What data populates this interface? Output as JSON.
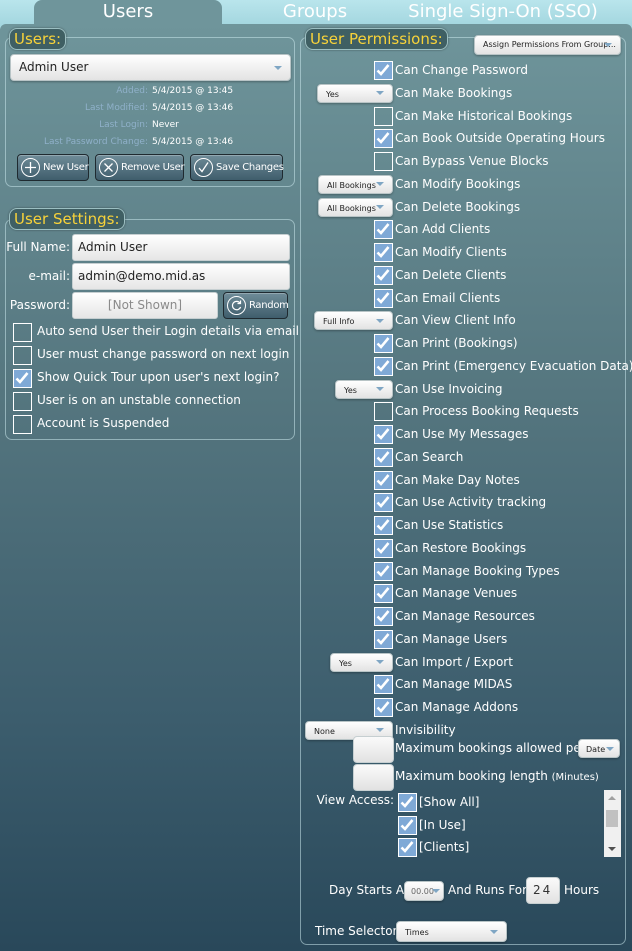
{
  "tabs": [
    {
      "label": "Users",
      "active": true
    },
    {
      "label": "Groups",
      "active": false
    },
    {
      "label": "Single Sign-On (SSO)",
      "active": false
    }
  ],
  "users_panel": {
    "legend": "Users:",
    "selected_user": "Admin User",
    "info": [
      {
        "label": "Added:",
        "value": "5/4/2015 @ 13:45"
      },
      {
        "label": "Last Modified:",
        "value": "5/4/2015 @ 13:46"
      },
      {
        "label": "Last Login:",
        "value": "Never"
      },
      {
        "label": "Last Password Change:",
        "value": "5/4/2015 @ 13:46"
      }
    ],
    "buttons": {
      "new_user": "New User",
      "remove_user": "Remove User",
      "save_changes": "Save Changes"
    }
  },
  "user_settings": {
    "legend": "User Settings:",
    "full_name_label": "Full Name:",
    "full_name_value": "Admin User",
    "email_label": "e-mail:",
    "email_value": "admin@demo.mid.as",
    "password_label": "Password:",
    "password_placeholder": "[Not Shown]",
    "random_button": "Random",
    "options": [
      {
        "label": "Auto send User their Login details via email",
        "checked": false
      },
      {
        "label": "User must change password on next login",
        "checked": false
      },
      {
        "label": "Show Quick Tour upon user's next login?",
        "checked": true
      },
      {
        "label": "User is on an unstable connection",
        "checked": false
      },
      {
        "label": "Account is Suspended",
        "checked": false
      }
    ]
  },
  "permissions": {
    "legend": "User Permissions:",
    "assign_from_group": "Assign Permissions From Group...",
    "items": [
      {
        "label": "Can Change Password",
        "type": "checkbox",
        "checked": true
      },
      {
        "label": "Can Make Bookings",
        "type": "select",
        "value": "Yes"
      },
      {
        "label": "Can Make Historical Bookings",
        "type": "checkbox",
        "checked": false
      },
      {
        "label": "Can Book Outside Operating Hours",
        "type": "checkbox",
        "checked": true
      },
      {
        "label": "Can Bypass Venue Blocks",
        "type": "checkbox",
        "checked": false
      },
      {
        "label": "Can Modify Bookings",
        "type": "select",
        "value": "All Bookings"
      },
      {
        "label": "Can Delete Bookings",
        "type": "select",
        "value": "All Bookings"
      },
      {
        "label": "Can Add Clients",
        "type": "checkbox",
        "checked": true
      },
      {
        "label": "Can Modify Clients",
        "type": "checkbox",
        "checked": true
      },
      {
        "label": "Can Delete Clients",
        "type": "checkbox",
        "checked": true
      },
      {
        "label": "Can Email Clients",
        "type": "checkbox",
        "checked": true
      },
      {
        "label": "Can View Client Info",
        "type": "select",
        "value": "Full Info"
      },
      {
        "label": "Can Print (Bookings)",
        "type": "checkbox",
        "checked": true
      },
      {
        "label": "Can Print (Emergency Evacuation Data)",
        "type": "checkbox",
        "checked": true
      },
      {
        "label": "Can Use Invoicing",
        "type": "select",
        "value": "Yes"
      },
      {
        "label": "Can Process Booking Requests",
        "type": "checkbox",
        "checked": false
      },
      {
        "label": "Can Use My Messages",
        "type": "checkbox",
        "checked": true
      },
      {
        "label": "Can Search",
        "type": "checkbox",
        "checked": true
      },
      {
        "label": "Can Make Day Notes",
        "type": "checkbox",
        "checked": true
      },
      {
        "label": "Can Use Activity tracking",
        "type": "checkbox",
        "checked": true
      },
      {
        "label": "Can Use Statistics",
        "type": "checkbox",
        "checked": true
      },
      {
        "label": "Can Restore Bookings",
        "type": "checkbox",
        "checked": true
      },
      {
        "label": "Can Manage Booking Types",
        "type": "checkbox",
        "checked": true
      },
      {
        "label": "Can Manage Venues",
        "type": "checkbox",
        "checked": true
      },
      {
        "label": "Can Manage Resources",
        "type": "checkbox",
        "checked": true
      },
      {
        "label": "Can Manage Users",
        "type": "checkbox",
        "checked": true
      },
      {
        "label": "Can Import / Export",
        "type": "select",
        "value": "Yes"
      },
      {
        "label": "Can Manage MIDAS",
        "type": "checkbox",
        "checked": true
      },
      {
        "label": "Can Manage Addons",
        "type": "checkbox",
        "checked": true
      },
      {
        "label": "Invisibility",
        "type": "select",
        "value": "None"
      }
    ],
    "max_bookings_label": "Maximum bookings allowed per",
    "max_bookings_value": "",
    "max_bookings_period": "Date",
    "max_length_label": "Maximum booking length",
    "max_length_unit": "(Minutes)",
    "max_length_value": "",
    "view_access_label": "View Access:",
    "view_access": [
      {
        "label": "[Show All]",
        "checked": true
      },
      {
        "label": "[In Use]",
        "checked": true
      },
      {
        "label": "[Clients]",
        "checked": true
      }
    ],
    "day_starts_label": "Day Starts At",
    "day_starts_value": "00.00",
    "runs_for_label": "And Runs For",
    "runs_for_value": "24",
    "hours_label": "Hours",
    "time_selector_label": "Time Selector:",
    "time_selector_value": "Times"
  }
}
